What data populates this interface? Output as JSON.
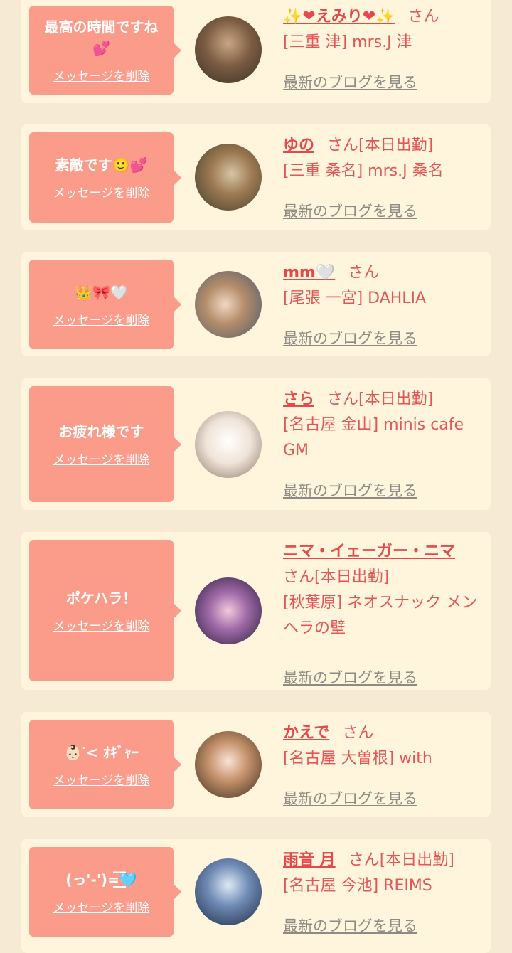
{
  "delete_label": "メッセージを削除",
  "blog_label": "最新のブログを見る",
  "san_label": "さん",
  "entries": [
    {
      "msg_line1": "最高の時間ですね",
      "msg_line2": "💕",
      "name": "✨❤えみり❤✨",
      "badge": "",
      "shop": "[三重 津] mrs.J 津"
    },
    {
      "msg_line1": "素敵です🙂💕",
      "msg_line2": "",
      "name": "ゆの",
      "badge": "[本日出勤]",
      "shop": "[三重 桑名] mrs.J 桑名"
    },
    {
      "msg_line1": "👑🎀🤍",
      "msg_line2": "",
      "name": "mm🤍",
      "badge": "",
      "shop": "[尾張 一宮] DAHLIA"
    },
    {
      "msg_line1": "お疲れ様です",
      "msg_line2": "",
      "name": "さら",
      "badge": "[本日出勤]",
      "shop": "[名古屋 金山] minis cafe GM"
    },
    {
      "msg_line1": "ポケハラ！",
      "msg_line2": "",
      "name": "ニマ・イェーガー・ニマ",
      "badge": "[本日出勤]",
      "shop": "[秋葉原] ネオスナック メンヘラの壁"
    },
    {
      "msg_line1": "👶🏻‪ᐝ< ｵｷﾞｬｰ",
      "msg_line2": "",
      "name": "かえで",
      "badge": "",
      "shop": "[名古屋 大曽根] with"
    },
    {
      "msg_line1": "(っ'-')=͟͟͞͞🩵",
      "msg_line2": "",
      "name": "雨音 月",
      "badge": "[本日出勤]",
      "shop": "[名古屋 今池] REIMS"
    }
  ],
  "colors": {
    "bubble": "#fb9b89",
    "card": "#fff5dc",
    "name": "#e5494a",
    "text": "#e25656",
    "link": "#8e8a84"
  }
}
